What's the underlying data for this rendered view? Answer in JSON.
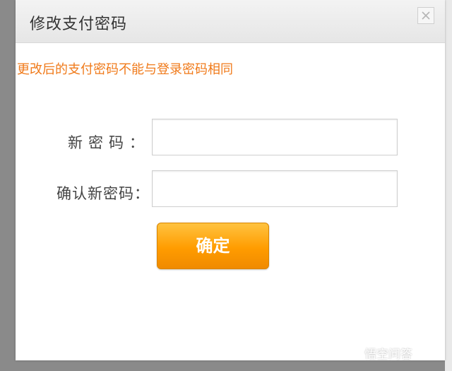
{
  "dialog": {
    "title": "修改支付密码",
    "close_icon": "close-icon",
    "notice": "更改后的支付密码不能与登录密码相同",
    "new_password_label": "新密码：",
    "confirm_password_label": "确认新密码：",
    "new_password_value": "",
    "confirm_password_value": "",
    "confirm_button_label": "确定"
  },
  "watermark": {
    "text": "悟空问答",
    "icon": "chat-bubble-icon"
  },
  "colors": {
    "notice": "#f07a1a",
    "button_top": "#ffc340",
    "button_bottom": "#f08a00"
  }
}
